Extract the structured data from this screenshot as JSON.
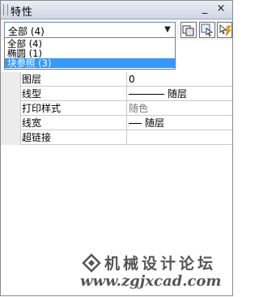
{
  "window": {
    "title": "特性",
    "close_label": "×",
    "minimize_label": "_"
  },
  "selector": {
    "value": "全部 (4)",
    "options": [
      "全部 (4)",
      "椭圆 (1)",
      "块参照 (3)"
    ],
    "selected_index": 2
  },
  "toolbar": {
    "icons": [
      "quick-select-icon",
      "select-objects-icon",
      "toggle-pickadd-icon"
    ]
  },
  "properties": [
    {
      "label": "图层",
      "value": "0"
    },
    {
      "label": "线型",
      "value": "随层"
    },
    {
      "label": "打印样式",
      "value": "随色"
    },
    {
      "label": "线宽",
      "value": "随层"
    },
    {
      "label": "超链接",
      "value": ""
    }
  ],
  "watermark": {
    "title": "机械设计论坛",
    "url": "www.zgjxcad.com"
  }
}
